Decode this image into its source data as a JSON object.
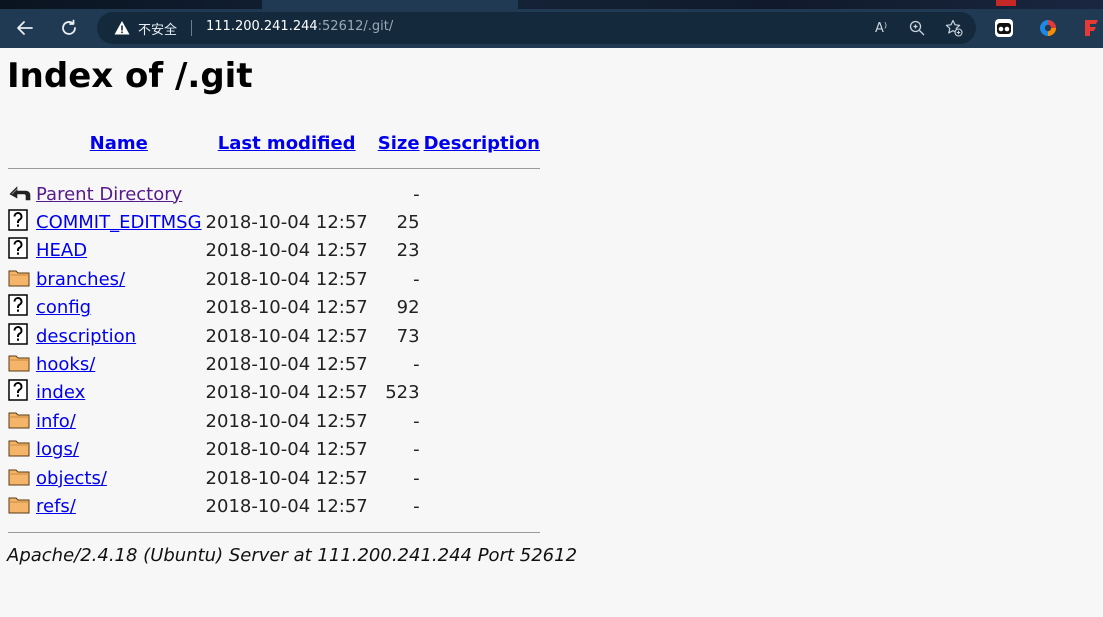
{
  "browser": {
    "security_label": "不安全",
    "url_host": "111.200.241.244",
    "url_rest": ":52612/.git/",
    "read_aloud_label": "A⁾"
  },
  "page": {
    "title": "Index of /.git",
    "columns": {
      "name": "Name",
      "last_modified": "Last modified",
      "size": "Size",
      "description": "Description"
    },
    "rows": [
      {
        "icon": "back-arrow-icon",
        "name": "Parent Directory",
        "date": "",
        "size": "-",
        "visited": true
      },
      {
        "icon": "unknown-file-icon",
        "name": "COMMIT_EDITMSG",
        "date": "2018-10-04 12:57",
        "size": "25"
      },
      {
        "icon": "unknown-file-icon",
        "name": "HEAD",
        "date": "2018-10-04 12:57",
        "size": "23"
      },
      {
        "icon": "folder-icon",
        "name": "branches/",
        "date": "2018-10-04 12:57",
        "size": "-"
      },
      {
        "icon": "unknown-file-icon",
        "name": "config",
        "date": "2018-10-04 12:57",
        "size": "92"
      },
      {
        "icon": "unknown-file-icon",
        "name": "description",
        "date": "2018-10-04 12:57",
        "size": "73"
      },
      {
        "icon": "folder-icon",
        "name": "hooks/",
        "date": "2018-10-04 12:57",
        "size": "-"
      },
      {
        "icon": "unknown-file-icon",
        "name": "index",
        "date": "2018-10-04 12:57",
        "size": "523"
      },
      {
        "icon": "folder-icon",
        "name": "info/",
        "date": "2018-10-04 12:57",
        "size": "-"
      },
      {
        "icon": "folder-icon",
        "name": "logs/",
        "date": "2018-10-04 12:57",
        "size": "-"
      },
      {
        "icon": "folder-icon",
        "name": "objects/",
        "date": "2018-10-04 12:57",
        "size": "-"
      },
      {
        "icon": "folder-icon",
        "name": "refs/",
        "date": "2018-10-04 12:57",
        "size": "-"
      }
    ],
    "footer": "Apache/2.4.18 (Ubuntu) Server at 111.200.241.244 Port 52612"
  },
  "colors": {
    "link": "#0000ee",
    "visited_link": "#551a8b",
    "toolbar": "#1f3a52",
    "page_bg": "#f7f7f7"
  }
}
